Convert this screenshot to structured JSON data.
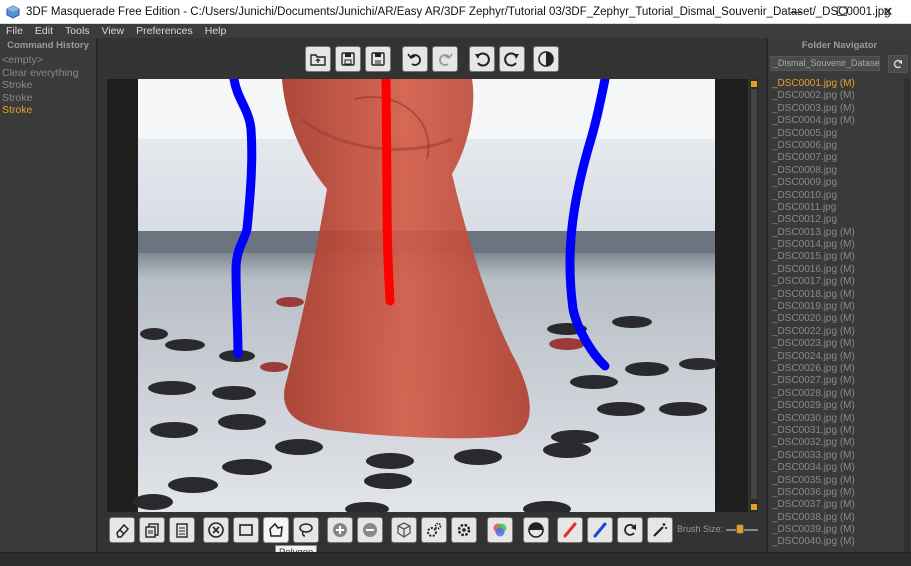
{
  "window": {
    "title": "3DF Masquerade Free Edition - C:/Users/Junichi/Documents/Junichi/AR/Easy AR/3DF Zephyr/Tutorial 03/3DF_Zephyr_Tutorial_Dismal_Souvenir_Dataset/_DSC0001.jpg",
    "minimize": "—",
    "maximize": "☐",
    "close": "✕"
  },
  "menu": [
    "File",
    "Edit",
    "Tools",
    "View",
    "Preferences",
    "Help"
  ],
  "command_history": {
    "header": "Command History",
    "items": [
      {
        "label": "<empty>",
        "active": false
      },
      {
        "label": "Clear everything",
        "active": false
      },
      {
        "label": "Stroke",
        "active": false
      },
      {
        "label": "Stroke",
        "active": false
      },
      {
        "label": "Stroke",
        "active": true
      }
    ]
  },
  "folder_navigator": {
    "header": "Folder Navigator",
    "folder": "_Dismal_Souvenir_Dataset",
    "files": [
      "_DSC0001.jpg (M)",
      "_DSC0002.jpg (M)",
      "_DSC0003.jpg (M)",
      "_DSC0004.jpg (M)",
      "_DSC0005.jpg",
      "_DSC0006.jpg",
      "_DSC0007.jpg",
      "_DSC0008.jpg",
      "_DSC0009.jpg",
      "_DSC0010.jpg",
      "_DSC0011.jpg",
      "_DSC0012.jpg",
      "_DSC0013.jpg (M)",
      "_DSC0014.jpg (M)",
      "_DSC0015.jpg (M)",
      "_DSC0016.jpg (M)",
      "_DSC0017.jpg (M)",
      "_DSC0018.jpg (M)",
      "_DSC0019.jpg (M)",
      "_DSC0020.jpg (M)",
      "_DSC0022.jpg (M)",
      "_DSC0023.jpg (M)",
      "_DSC0024.jpg (M)",
      "_DSC0026.jpg (M)",
      "_DSC0027.jpg (M)",
      "_DSC0028.jpg (M)",
      "_DSC0029.jpg (M)",
      "_DSC0030.jpg (M)",
      "_DSC0031.jpg (M)",
      "_DSC0032.jpg (M)",
      "_DSC0033.jpg (M)",
      "_DSC0034.jpg (M)",
      "_DSC0035.jpg (M)",
      "_DSC0036.jpg (M)",
      "_DSC0037.jpg (M)",
      "_DSC0038.jpg (M)",
      "_DSC0039.jpg (M)",
      "_DSC0040.jpg (M)"
    ],
    "active_index": 0
  },
  "bottom_toolbar": {
    "brush_size_label": "Brush Size:",
    "tooltip": "Polygon"
  },
  "colors": {
    "accent": "#e8a030",
    "foreground_stroke": "#ff0000",
    "background_stroke": "#0000ff",
    "mask_tint": "#c84632"
  }
}
